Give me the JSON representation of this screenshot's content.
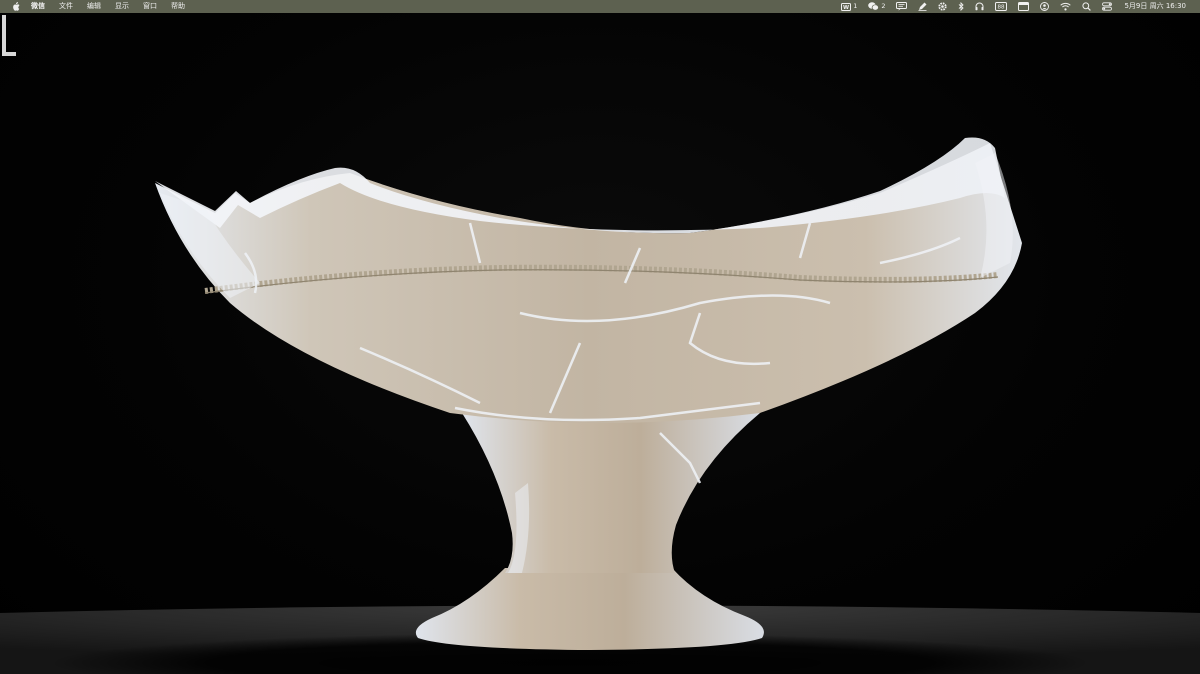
{
  "menubar": {
    "apple_icon": "apple-logo-icon",
    "app_name": "微信",
    "menus": [
      "文件",
      "编辑",
      "显示",
      "窗口",
      "帮助"
    ],
    "status": {
      "mail_count": "1",
      "wechat_count": "2",
      "clock": "5月9日 周六  16:30"
    },
    "icons": [
      "mail-icon",
      "wechat-icon",
      "chat-icon",
      "pen-icon",
      "settings-icon",
      "bluetooth-icon",
      "headphones-icon",
      "display-icon",
      "window-icon",
      "user-icon",
      "wifi-icon",
      "search-icon",
      "control-center-icon"
    ],
    "colors": {
      "bar": "#5d6150",
      "text": "#f0f0f0"
    }
  },
  "photo": {
    "subject": "pottery-pedestal-bowl",
    "colors": {
      "background": "#000000",
      "clay": "#c8bdae",
      "highlight": "#e8ecf2",
      "table": "#2a2a2a"
    }
  }
}
